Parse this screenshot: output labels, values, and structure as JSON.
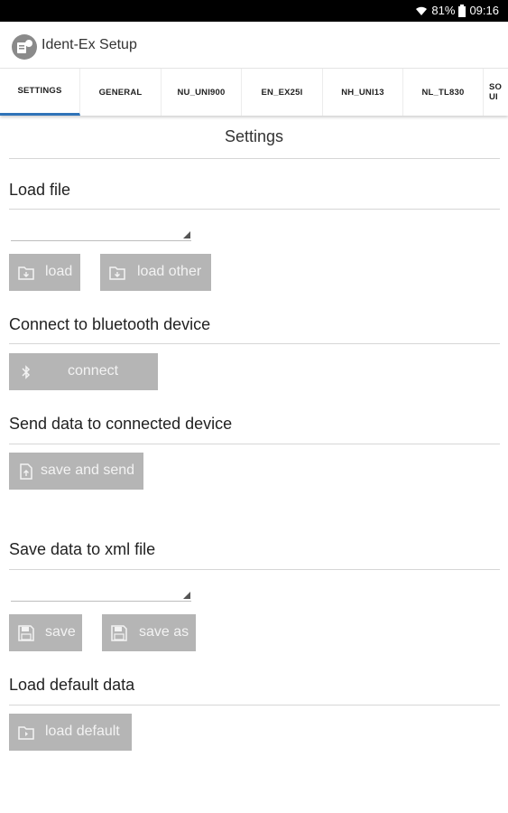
{
  "status_bar": {
    "battery": "81%",
    "time": "09:16",
    "icons": [
      "wifi-icon",
      "battery-icon"
    ]
  },
  "app": {
    "title": "Ident-Ex Setup",
    "icon": "app-logo-icon"
  },
  "tabs": [
    {
      "label": "SETTINGS",
      "active": true
    },
    {
      "label": "GENERAL"
    },
    {
      "label": "NU_UNI900"
    },
    {
      "label": "EN_EX25I"
    },
    {
      "label": "NH_UNI13"
    },
    {
      "label": "NL_TL830"
    },
    {
      "label_line1": "SO",
      "label_line2": "UI"
    }
  ],
  "page_title": "Settings",
  "load_file": {
    "heading": "Load file",
    "spinner_value": "",
    "load_button": "load",
    "load_other_button": "load other"
  },
  "bluetooth": {
    "heading": "Connect to bluetooth device",
    "connect_button": "connect"
  },
  "send_data": {
    "heading": "Send data to connected device",
    "save_send_button": "save and send"
  },
  "save_xml": {
    "heading": "Save data to xml file",
    "spinner_value": "",
    "save_button": "save",
    "save_as_button": "save as"
  },
  "load_default": {
    "heading": "Load default data",
    "load_default_button": "load default"
  },
  "colors": {
    "button_bg": "#b5b5b5",
    "button_text": "#f3f3f3",
    "tab_indicator": "#2f73b8",
    "status_bar": "#000000"
  }
}
